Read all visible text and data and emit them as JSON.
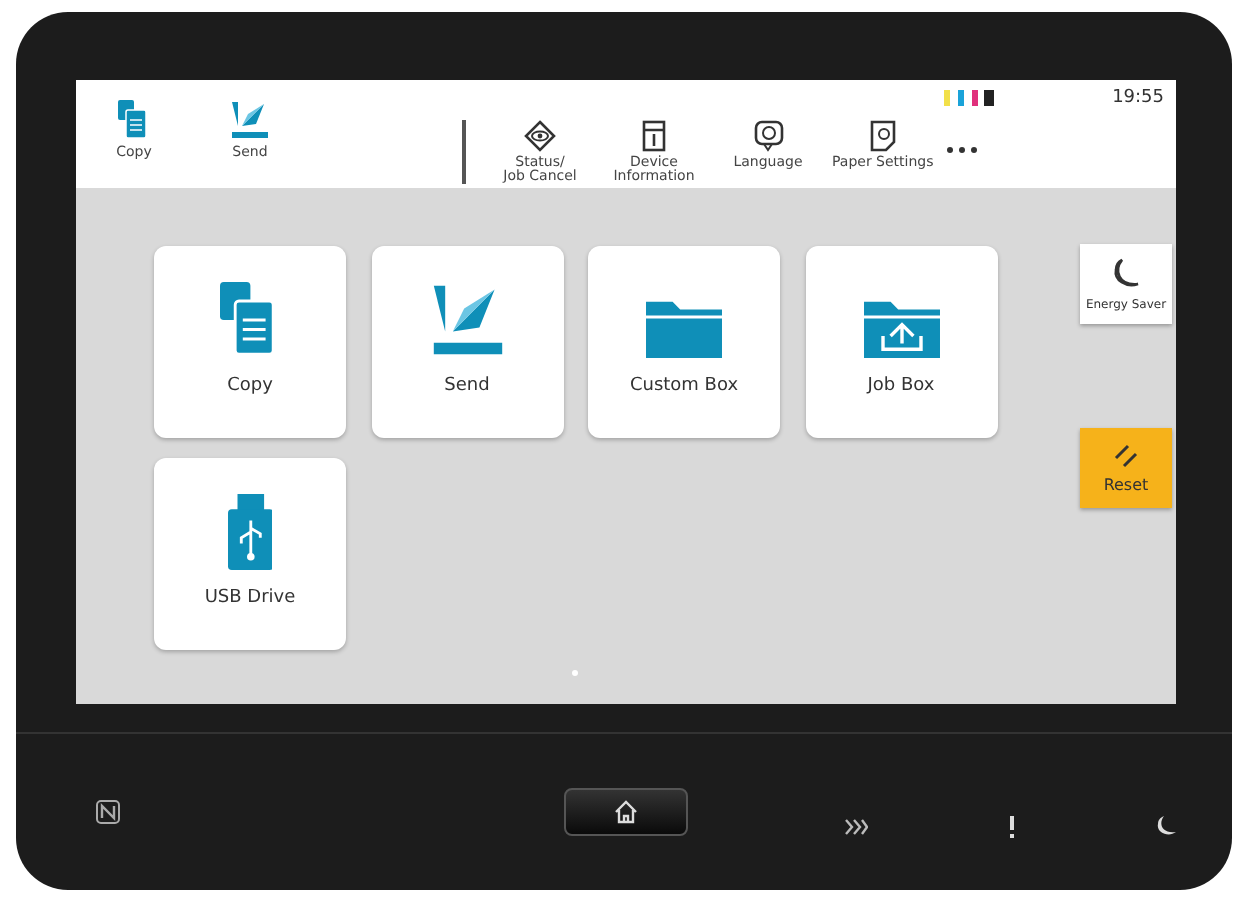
{
  "status_bar": {
    "time": "19:55"
  },
  "quick_access": [
    {
      "label": "Copy",
      "kind": "copy"
    },
    {
      "label": "Send",
      "kind": "send"
    }
  ],
  "toolbar": [
    {
      "label": "Status/\nJob Cancel",
      "kind": "status"
    },
    {
      "label": "Device\nInformation",
      "kind": "device"
    },
    {
      "label": "Language",
      "kind": "language"
    },
    {
      "label": "Paper Settings",
      "kind": "paper"
    }
  ],
  "apps": [
    {
      "label": "Copy",
      "kind": "copy"
    },
    {
      "label": "Send",
      "kind": "send"
    },
    {
      "label": "Custom Box",
      "kind": "folder"
    },
    {
      "label": "Job Box",
      "kind": "job-box"
    },
    {
      "label": "USB Drive",
      "kind": "usb"
    }
  ],
  "side_buttons": [
    {
      "label": "Energy Saver",
      "kind": "energy"
    },
    {
      "label": "Reset",
      "kind": "reset"
    }
  ]
}
